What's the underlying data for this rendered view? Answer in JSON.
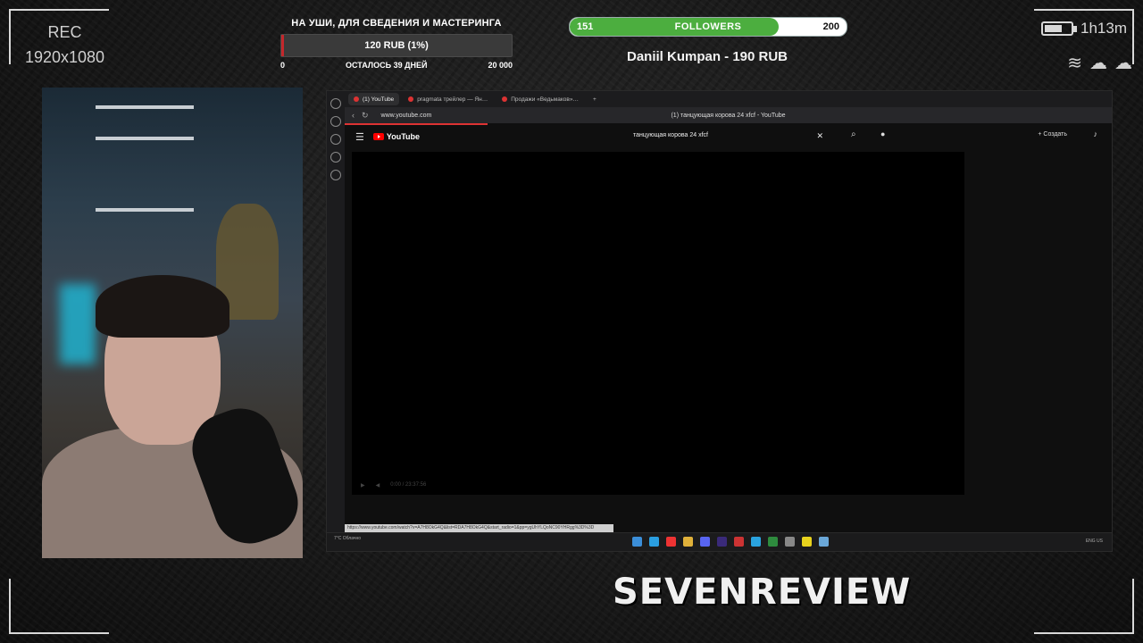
{
  "overlay": {
    "rec_label": "REC",
    "resolution": "1920x1080",
    "elapsed": "1h13m",
    "donation_goal": {
      "title": "НА УШИ, ДЛЯ СВЕДЕНИЯ И МАСТЕРИНГА",
      "progress_text": "120 RUB (1%)",
      "progress_fraction": 0.01,
      "min": "0",
      "remaining": "ОСТАЛОСЬ 39 ДНЕЙ",
      "max": "20 000"
    },
    "followers": {
      "current": "151",
      "label": "FOLLOWERS",
      "goal": "200",
      "progress_fraction": 0.755
    },
    "last_donation": "Daniil Kumpan - 190 RUB",
    "brand": "SEVENREVIEW"
  },
  "browser": {
    "tabs": [
      {
        "label": "(1) YouTube",
        "active": true
      },
      {
        "label": "pragmata трейлер — Ян…",
        "active": false
      },
      {
        "label": "Продажи «Ведьмаков»…",
        "active": false
      }
    ],
    "url": "www.youtube.com",
    "page_title": "(1) танцующая корова 24 xfcf - YouTube",
    "youtube": {
      "logo_text": "YouTube",
      "search_value": "танцующая корова 24 xfcf",
      "create_label": "Создать"
    },
    "player": {
      "time": "0:00 / 23:37:56"
    },
    "status_url": "https://www.youtube.com/watch?v=A7H8OkG4Q&list=RDA7H8OkG4Q&start_radio=1&pp=ygUhYLQoNC90YHRgg%3D%3D"
  },
  "taskbar": {
    "weather": "7°C Облачно",
    "lang": "ENG US"
  },
  "colors": {
    "goal_fill": "#c3272b",
    "followers_fill": "#4cae3f",
    "youtube_red": "#ff0000"
  }
}
